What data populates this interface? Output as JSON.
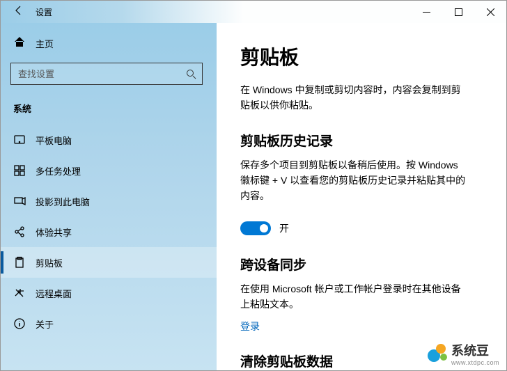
{
  "titlebar": {
    "title": "设置"
  },
  "sidebar": {
    "home": "主页",
    "search_placeholder": "查找设置",
    "category": "系统",
    "items": [
      {
        "label": "平板电脑"
      },
      {
        "label": "多任务处理"
      },
      {
        "label": "投影到此电脑"
      },
      {
        "label": "体验共享"
      },
      {
        "label": "剪贴板"
      },
      {
        "label": "远程桌面"
      },
      {
        "label": "关于"
      }
    ]
  },
  "content": {
    "title": "剪贴板",
    "intro": "在 Windows 中复制或剪切内容时，内容会复制到剪贴板以供你粘贴。",
    "history": {
      "heading": "剪贴板历史记录",
      "desc": "保存多个项目到剪贴板以备稍后使用。按 Windows 徽标键 + V 以查看您的剪贴板历史记录并粘贴其中的内容。",
      "toggle_label": "开"
    },
    "sync": {
      "heading": "跨设备同步",
      "desc": "在使用 Microsoft 帐户或工作帐户登录时在其他设备上粘贴文本。",
      "link": "登录"
    },
    "clear": {
      "heading": "清除剪贴板数据"
    }
  },
  "watermark": {
    "brand": "系统豆",
    "url": "www.xtdpc.com"
  }
}
